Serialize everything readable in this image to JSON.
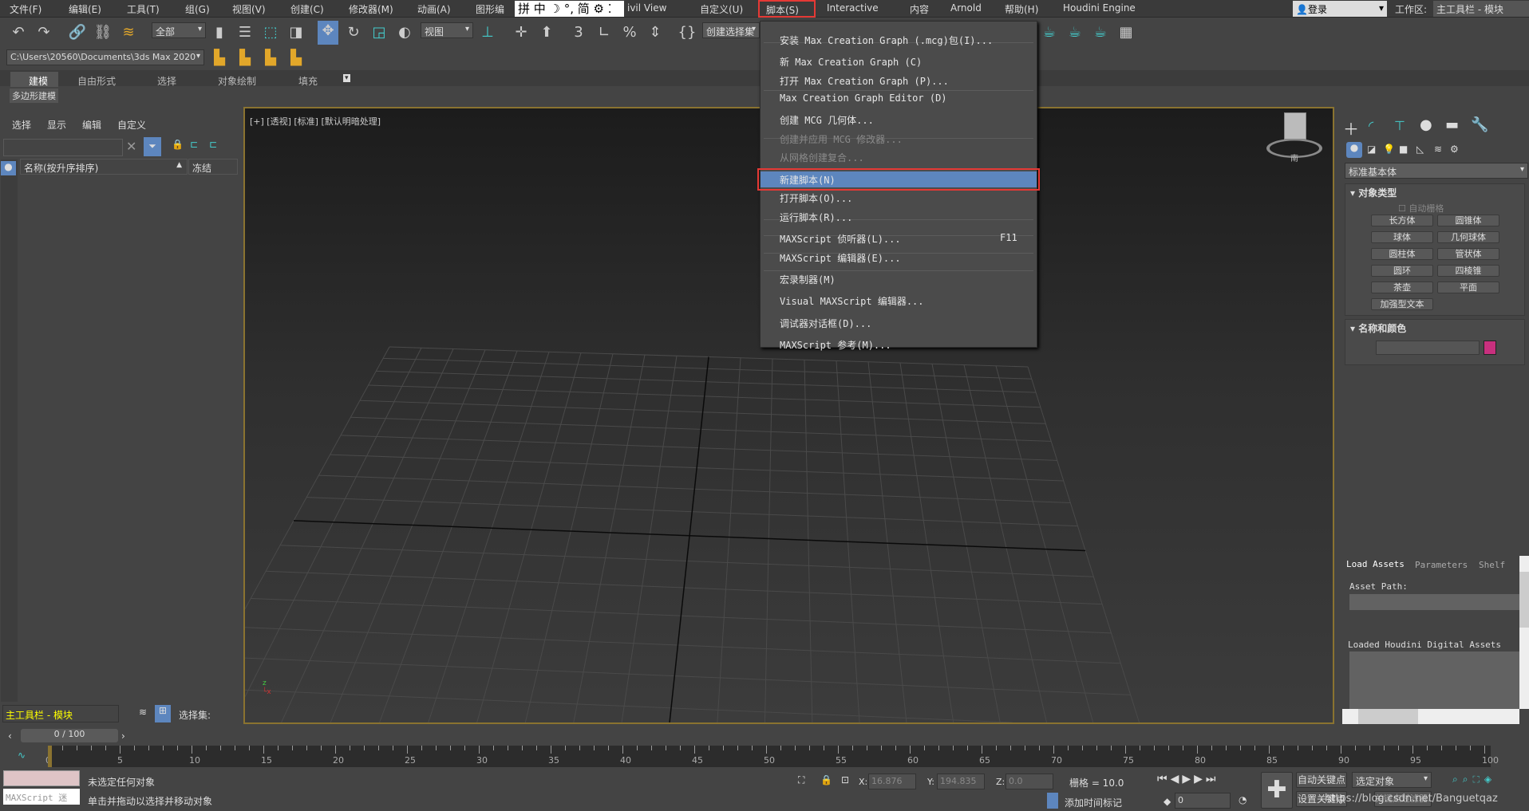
{
  "menubar": {
    "items": [
      "文件(F)",
      "编辑(E)",
      "工具(T)",
      "组(G)",
      "视图(V)",
      "创建(C)",
      "修改器(M)",
      "动画(A)",
      "图形编",
      "ivil View",
      "自定义(U)",
      "脚本(S)",
      "Interactive",
      "内容",
      "Arnold",
      "帮助(H)",
      "Houdini Engine"
    ],
    "ime": "拼 中 ☽ °, 简 ⚙ ⁚",
    "login": "登录",
    "workspace_label": "工作区:",
    "workspace_value": "主工具栏 - 模块"
  },
  "toolbar": {
    "selection_filter": "全部",
    "ref_coord": "视图",
    "named_selection": "创建选择集",
    "project_path": "C:\\Users\\20560\\Documents\\3ds Max 2020"
  },
  "ribbon": {
    "tabs": [
      "建模",
      "自由形式",
      "选择",
      "对象绘制",
      "填充"
    ],
    "sub": "多边形建模"
  },
  "scene_explorer": {
    "menu": [
      "选择",
      "显示",
      "编辑",
      "自定义"
    ],
    "col_name": "名称(按升序排序)",
    "col_frozen": "冻结"
  },
  "viewport": {
    "label": "[+] [透视] [标准] [默认明暗处理]",
    "compass": "南"
  },
  "script_menu": {
    "items": [
      {
        "label": "安装 Max Creation Graph (.mcg)包(I)...",
        "enabled": true
      },
      {
        "label": "新 Max Creation Graph (C)",
        "enabled": true
      },
      {
        "label": "打开 Max Creation Graph (P)...",
        "enabled": true
      },
      {
        "label": "Max Creation Graph Editor (D)",
        "enabled": true
      },
      {
        "label": "创建 MCG 几何体...",
        "enabled": true
      },
      {
        "label": "创建并应用 MCG 修改器...",
        "enabled": false
      },
      {
        "label": "从网格创建复合...",
        "enabled": false
      },
      {
        "label": "新建脚本(N)",
        "enabled": true,
        "highlighted": true
      },
      {
        "label": "打开脚本(O)...",
        "enabled": true
      },
      {
        "label": "运行脚本(R)...",
        "enabled": true
      },
      {
        "label": "MAXScript 侦听器(L)...",
        "enabled": true,
        "shortcut": "F11"
      },
      {
        "label": "MAXScript 编辑器(E)...",
        "enabled": true
      },
      {
        "label": "宏录制器(M)",
        "enabled": true
      },
      {
        "label": "Visual MAXScript 编辑器...",
        "enabled": true
      },
      {
        "label": "调试器对话框(D)...",
        "enabled": true
      },
      {
        "label": "MAXScript 参考(M)...",
        "enabled": true
      }
    ]
  },
  "command_panel": {
    "category": "标准基本体",
    "rollout1": "对象类型",
    "autogrid": "自动栅格",
    "buttons": [
      "长方体",
      "圆锥体",
      "球体",
      "几何球体",
      "圆柱体",
      "管状体",
      "圆环",
      "四棱锥",
      "茶壶",
      "平面",
      "加强型文本"
    ],
    "rollout2": "名称和颜色",
    "object_color": "#c8307e"
  },
  "houdini": {
    "tabs": [
      "Load Assets",
      "Parameters",
      "Shelf"
    ],
    "asset_path": "Asset Path:",
    "loaded": "Loaded Houdini Digital Assets"
  },
  "bottom": {
    "workspace": "主工具栏 - 模块",
    "selection_set": "选择集:",
    "frame": "0 / 100",
    "ticks": [
      "0",
      "5",
      "10",
      "15",
      "20",
      "25",
      "30",
      "35",
      "40",
      "45",
      "50",
      "55",
      "60",
      "65",
      "70",
      "75",
      "80",
      "85",
      "90",
      "95",
      "100"
    ],
    "maxscript": "MAXScript 迷",
    "status1": "未选定任何对象",
    "status2": "单击并拖动以选择并移动对象",
    "x_label": "X:",
    "x": "16.876",
    "y_label": "Y:",
    "y": "194.835",
    "z_label": "Z:",
    "z": "0.0",
    "grid": "栅格 = 10.0",
    "add_tag": "添加时间标记",
    "auto_key": "自动关键点",
    "set_key": "设置关键点",
    "key_target": "选定对象",
    "key_filter": "关键点过滤器...",
    "current_frame": "0",
    "watermark": "https://blog.csdn.net/Banguetqaz"
  }
}
